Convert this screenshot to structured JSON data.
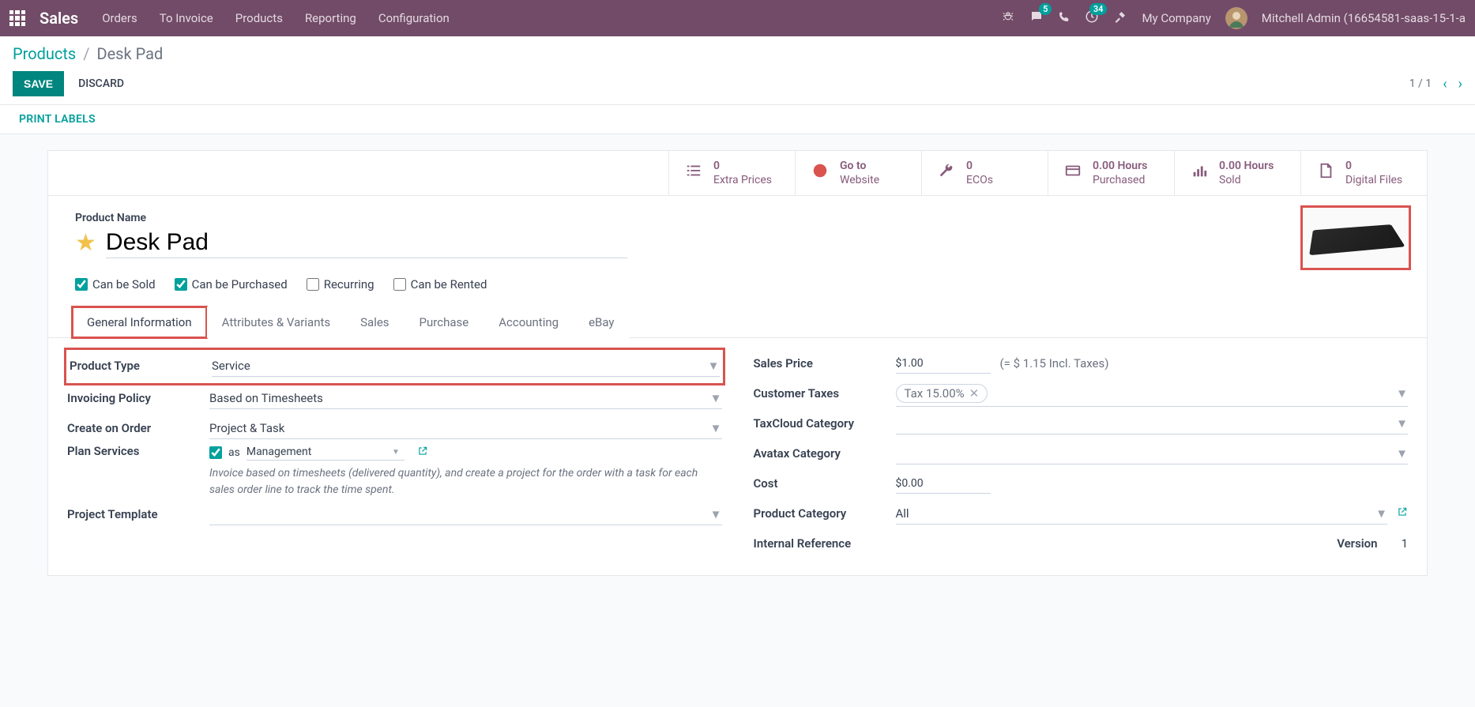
{
  "navbar": {
    "brand": "Sales",
    "menu": [
      "Orders",
      "To Invoice",
      "Products",
      "Reporting",
      "Configuration"
    ],
    "messages_badge": "5",
    "activities_badge": "34",
    "company": "My Company",
    "user": "Mitchell Admin (16654581-saas-15-1-a"
  },
  "breadcrumb": {
    "parent": "Products",
    "current": "Desk Pad"
  },
  "actions": {
    "save": "SAVE",
    "discard": "DISCARD",
    "pager": "1 / 1"
  },
  "statusbar": {
    "print_labels": "PRINT LABELS"
  },
  "stat_buttons": [
    {
      "icon": "list",
      "value": "0",
      "label": "Extra Prices"
    },
    {
      "icon": "globe",
      "value": "Go to",
      "label": "Website",
      "red": true
    },
    {
      "icon": "wrench",
      "value": "0",
      "label": "ECOs"
    },
    {
      "icon": "card",
      "value": "0.00 Hours",
      "label": "Purchased"
    },
    {
      "icon": "bars",
      "value": "0.00 Hours",
      "label": "Sold"
    },
    {
      "icon": "file",
      "value": "0",
      "label": "Digital Files"
    }
  ],
  "product": {
    "name_label": "Product Name",
    "name": "Desk Pad",
    "checks": {
      "can_be_sold": "Can be Sold",
      "can_be_purchased": "Can be Purchased",
      "recurring": "Recurring",
      "can_be_rented": "Can be Rented"
    }
  },
  "tabs": [
    "General Information",
    "Attributes & Variants",
    "Sales",
    "Purchase",
    "Accounting",
    "eBay"
  ],
  "form": {
    "left": {
      "product_type_label": "Product Type",
      "product_type": "Service",
      "invoicing_policy_label": "Invoicing Policy",
      "invoicing_policy": "Based on Timesheets",
      "create_on_order_label": "Create on Order",
      "create_on_order": "Project & Task",
      "plan_services_label": "Plan Services",
      "plan_as": "as",
      "plan_value": "Management",
      "help": "Invoice based on timesheets (delivered quantity), and create a project for the order with a task for each sales order line to track the time spent.",
      "project_template_label": "Project Template"
    },
    "right": {
      "sales_price_label": "Sales Price",
      "sales_price": "$1.00",
      "sales_price_note": "(= $ 1.15 Incl. Taxes)",
      "customer_taxes_label": "Customer Taxes",
      "customer_taxes_tag": "Tax 15.00%",
      "taxcloud_label": "TaxCloud Category",
      "avatax_label": "Avatax Category",
      "cost_label": "Cost",
      "cost": "$0.00",
      "product_category_label": "Product Category",
      "product_category": "All",
      "internal_ref_label": "Internal Reference",
      "version_label": "Version",
      "version": "1"
    }
  }
}
